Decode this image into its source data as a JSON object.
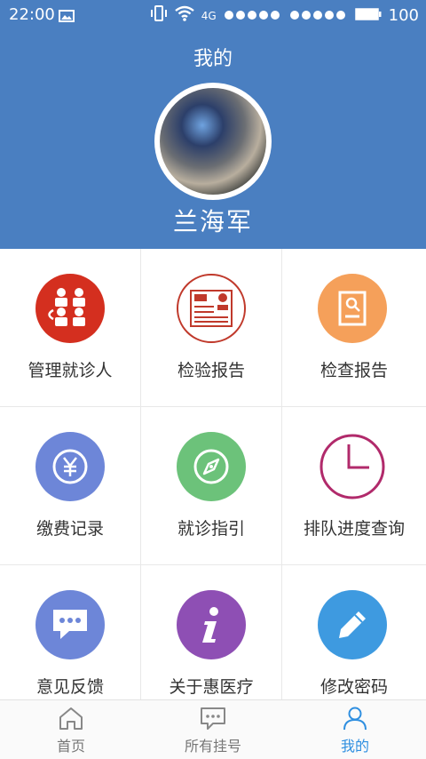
{
  "status_bar": {
    "time": "22:00",
    "network": "4G",
    "battery": "100"
  },
  "header": {
    "title": "我的",
    "user_name": "兰海军"
  },
  "menu": {
    "items": [
      {
        "label": "管理就诊人",
        "icon": "patients-group-icon",
        "color": "#d42f1f"
      },
      {
        "label": "检验报告",
        "icon": "lab-report-icon",
        "color": "#c0392b"
      },
      {
        "label": "检查报告",
        "icon": "exam-report-icon",
        "color": "#f5a05a"
      },
      {
        "label": "缴费记录",
        "icon": "yuan-payment-icon",
        "color": "#6d86d8"
      },
      {
        "label": "就诊指引",
        "icon": "compass-icon",
        "color": "#6cc27a"
      },
      {
        "label": "排队进度查询",
        "icon": "clock-icon",
        "color": "#b12a6b"
      },
      {
        "label": "意见反馈",
        "icon": "chat-feedback-icon",
        "color": "#6d86d8"
      },
      {
        "label": "关于惠医疗",
        "icon": "info-icon",
        "color": "#8e4fb4"
      },
      {
        "label": "修改密码",
        "icon": "pencil-icon",
        "color": "#3e9ae0"
      }
    ]
  },
  "tabbar": {
    "tabs": [
      {
        "label": "首页",
        "icon": "home-icon"
      },
      {
        "label": "所有挂号",
        "icon": "message-icon"
      },
      {
        "label": "我的",
        "icon": "user-icon",
        "active": true
      }
    ]
  }
}
